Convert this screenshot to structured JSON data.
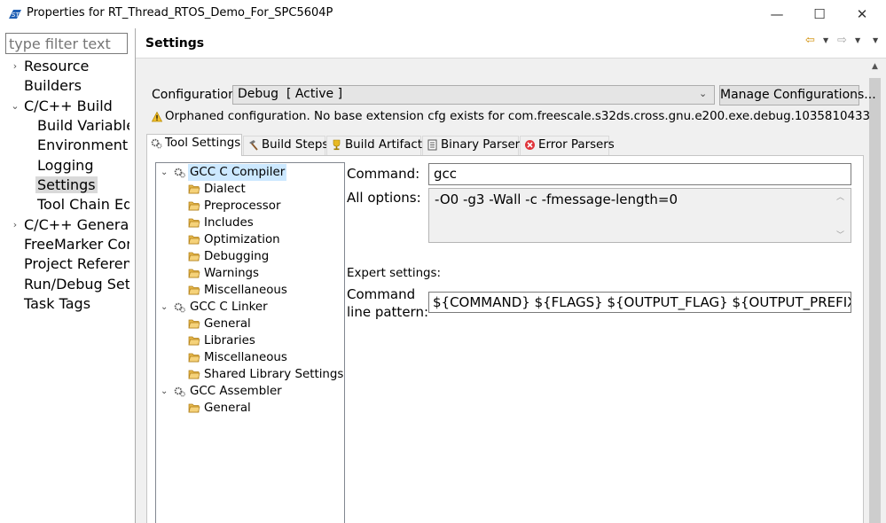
{
  "window": {
    "title": "Properties for RT_Thread_RTOS_Demo_For_SPC5604P",
    "minimize": "—",
    "maximize": "☐",
    "close": "✕"
  },
  "filter": {
    "placeholder": "type filter text"
  },
  "nav": [
    {
      "label": "Resource",
      "arrow": "›"
    },
    {
      "label": "Builders",
      "arrow": ""
    },
    {
      "label": "C/C++ Build",
      "arrow": "⌄"
    },
    {
      "label": "Build Variables",
      "arrow": ""
    },
    {
      "label": "Environment",
      "arrow": ""
    },
    {
      "label": "Logging",
      "arrow": ""
    },
    {
      "label": "Settings",
      "arrow": ""
    },
    {
      "label": "Tool Chain Editor",
      "arrow": ""
    },
    {
      "label": "C/C++ General",
      "arrow": "›"
    },
    {
      "label": "FreeMarker Context",
      "arrow": ""
    },
    {
      "label": "Project References",
      "arrow": ""
    },
    {
      "label": "Run/Debug Settings",
      "arrow": ""
    },
    {
      "label": "Task Tags",
      "arrow": ""
    }
  ],
  "header": {
    "title": "Settings",
    "back": "⇦",
    "forward": "⇨",
    "dropdown": "▼"
  },
  "config": {
    "label": "Configuration:",
    "value": "Debug  [ Active ]",
    "manage_label": "Manage Configurations...",
    "warning": "Orphaned configuration. No base extension cfg exists for com.freescale.s32ds.cross.gnu.e200.exe.debug.1035810433"
  },
  "tabs": [
    {
      "label": "Tool Settings"
    },
    {
      "label": "Build Steps"
    },
    {
      "label": "Build Artifact"
    },
    {
      "label": "Binary Parsers"
    },
    {
      "label": "Error Parsers"
    }
  ],
  "tool_tree": [
    {
      "label": "GCC C Compiler",
      "type": "tool"
    },
    {
      "label": "Dialect",
      "type": "folder"
    },
    {
      "label": "Preprocessor",
      "type": "folder"
    },
    {
      "label": "Includes",
      "type": "folder"
    },
    {
      "label": "Optimization",
      "type": "folder"
    },
    {
      "label": "Debugging",
      "type": "folder"
    },
    {
      "label": "Warnings",
      "type": "folder"
    },
    {
      "label": "Miscellaneous",
      "type": "folder"
    },
    {
      "label": "GCC C Linker",
      "type": "tool"
    },
    {
      "label": "General",
      "type": "folder"
    },
    {
      "label": "Libraries",
      "type": "folder"
    },
    {
      "label": "Miscellaneous",
      "type": "folder"
    },
    {
      "label": "Shared Library Settings",
      "type": "folder"
    },
    {
      "label": "GCC Assembler",
      "type": "tool"
    },
    {
      "label": "General",
      "type": "folder"
    }
  ],
  "tool": {
    "command_label": "Command:",
    "command_value": "gcc",
    "all_options_label": "All options:",
    "all_options_value": "-O0 -g3 -Wall -c -fmessage-length=0",
    "expert_label": "Expert settings:",
    "pattern_label_line1": "Command",
    "pattern_label_line2": "line pattern:",
    "pattern_value": "${COMMAND} ${FLAGS} ${OUTPUT_FLAG} ${OUTPUT_PREFIX}${OUTPUT} ${INPUTS}"
  },
  "colors": {
    "selection": "#cce8ff",
    "nav_selection": "#d9d9d9",
    "panel": "#f0f0f0",
    "accent_arrow": "#d08b00",
    "error": "#e0353b"
  }
}
